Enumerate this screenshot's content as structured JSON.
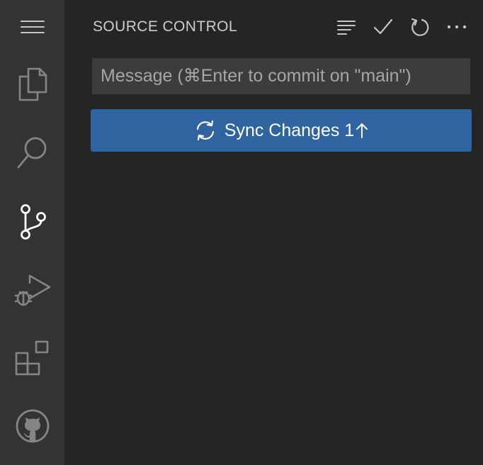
{
  "activity_bar": {
    "items": [
      {
        "name": "menu",
        "icon": "hamburger-menu-icon"
      },
      {
        "name": "explorer",
        "icon": "files-icon"
      },
      {
        "name": "search",
        "icon": "search-icon"
      },
      {
        "name": "source-control",
        "icon": "source-control-icon",
        "active": true
      },
      {
        "name": "run-and-debug",
        "icon": "debug-icon"
      },
      {
        "name": "extensions",
        "icon": "extensions-icon"
      },
      {
        "name": "github",
        "icon": "github-icon"
      }
    ]
  },
  "sidebar": {
    "title": "SOURCE CONTROL",
    "actions": [
      "view-as-tree-icon",
      "commit-check-icon",
      "refresh-icon",
      "more-actions-icon"
    ]
  },
  "commit": {
    "placeholder": "Message (⌘Enter to commit on \"main\")",
    "value": ""
  },
  "sync_button": {
    "label": "Sync Changes 1",
    "icon": "sync-icon",
    "arrow": "arrow-up-icon"
  },
  "colors": {
    "activity_bar_bg": "#333333",
    "sidebar_bg": "#252526",
    "input_bg": "#3c3c3c",
    "button_bg": "#2f64a0",
    "icon_inactive": "#858585",
    "icon_active": "#ffffff",
    "text": "#cccccc"
  }
}
